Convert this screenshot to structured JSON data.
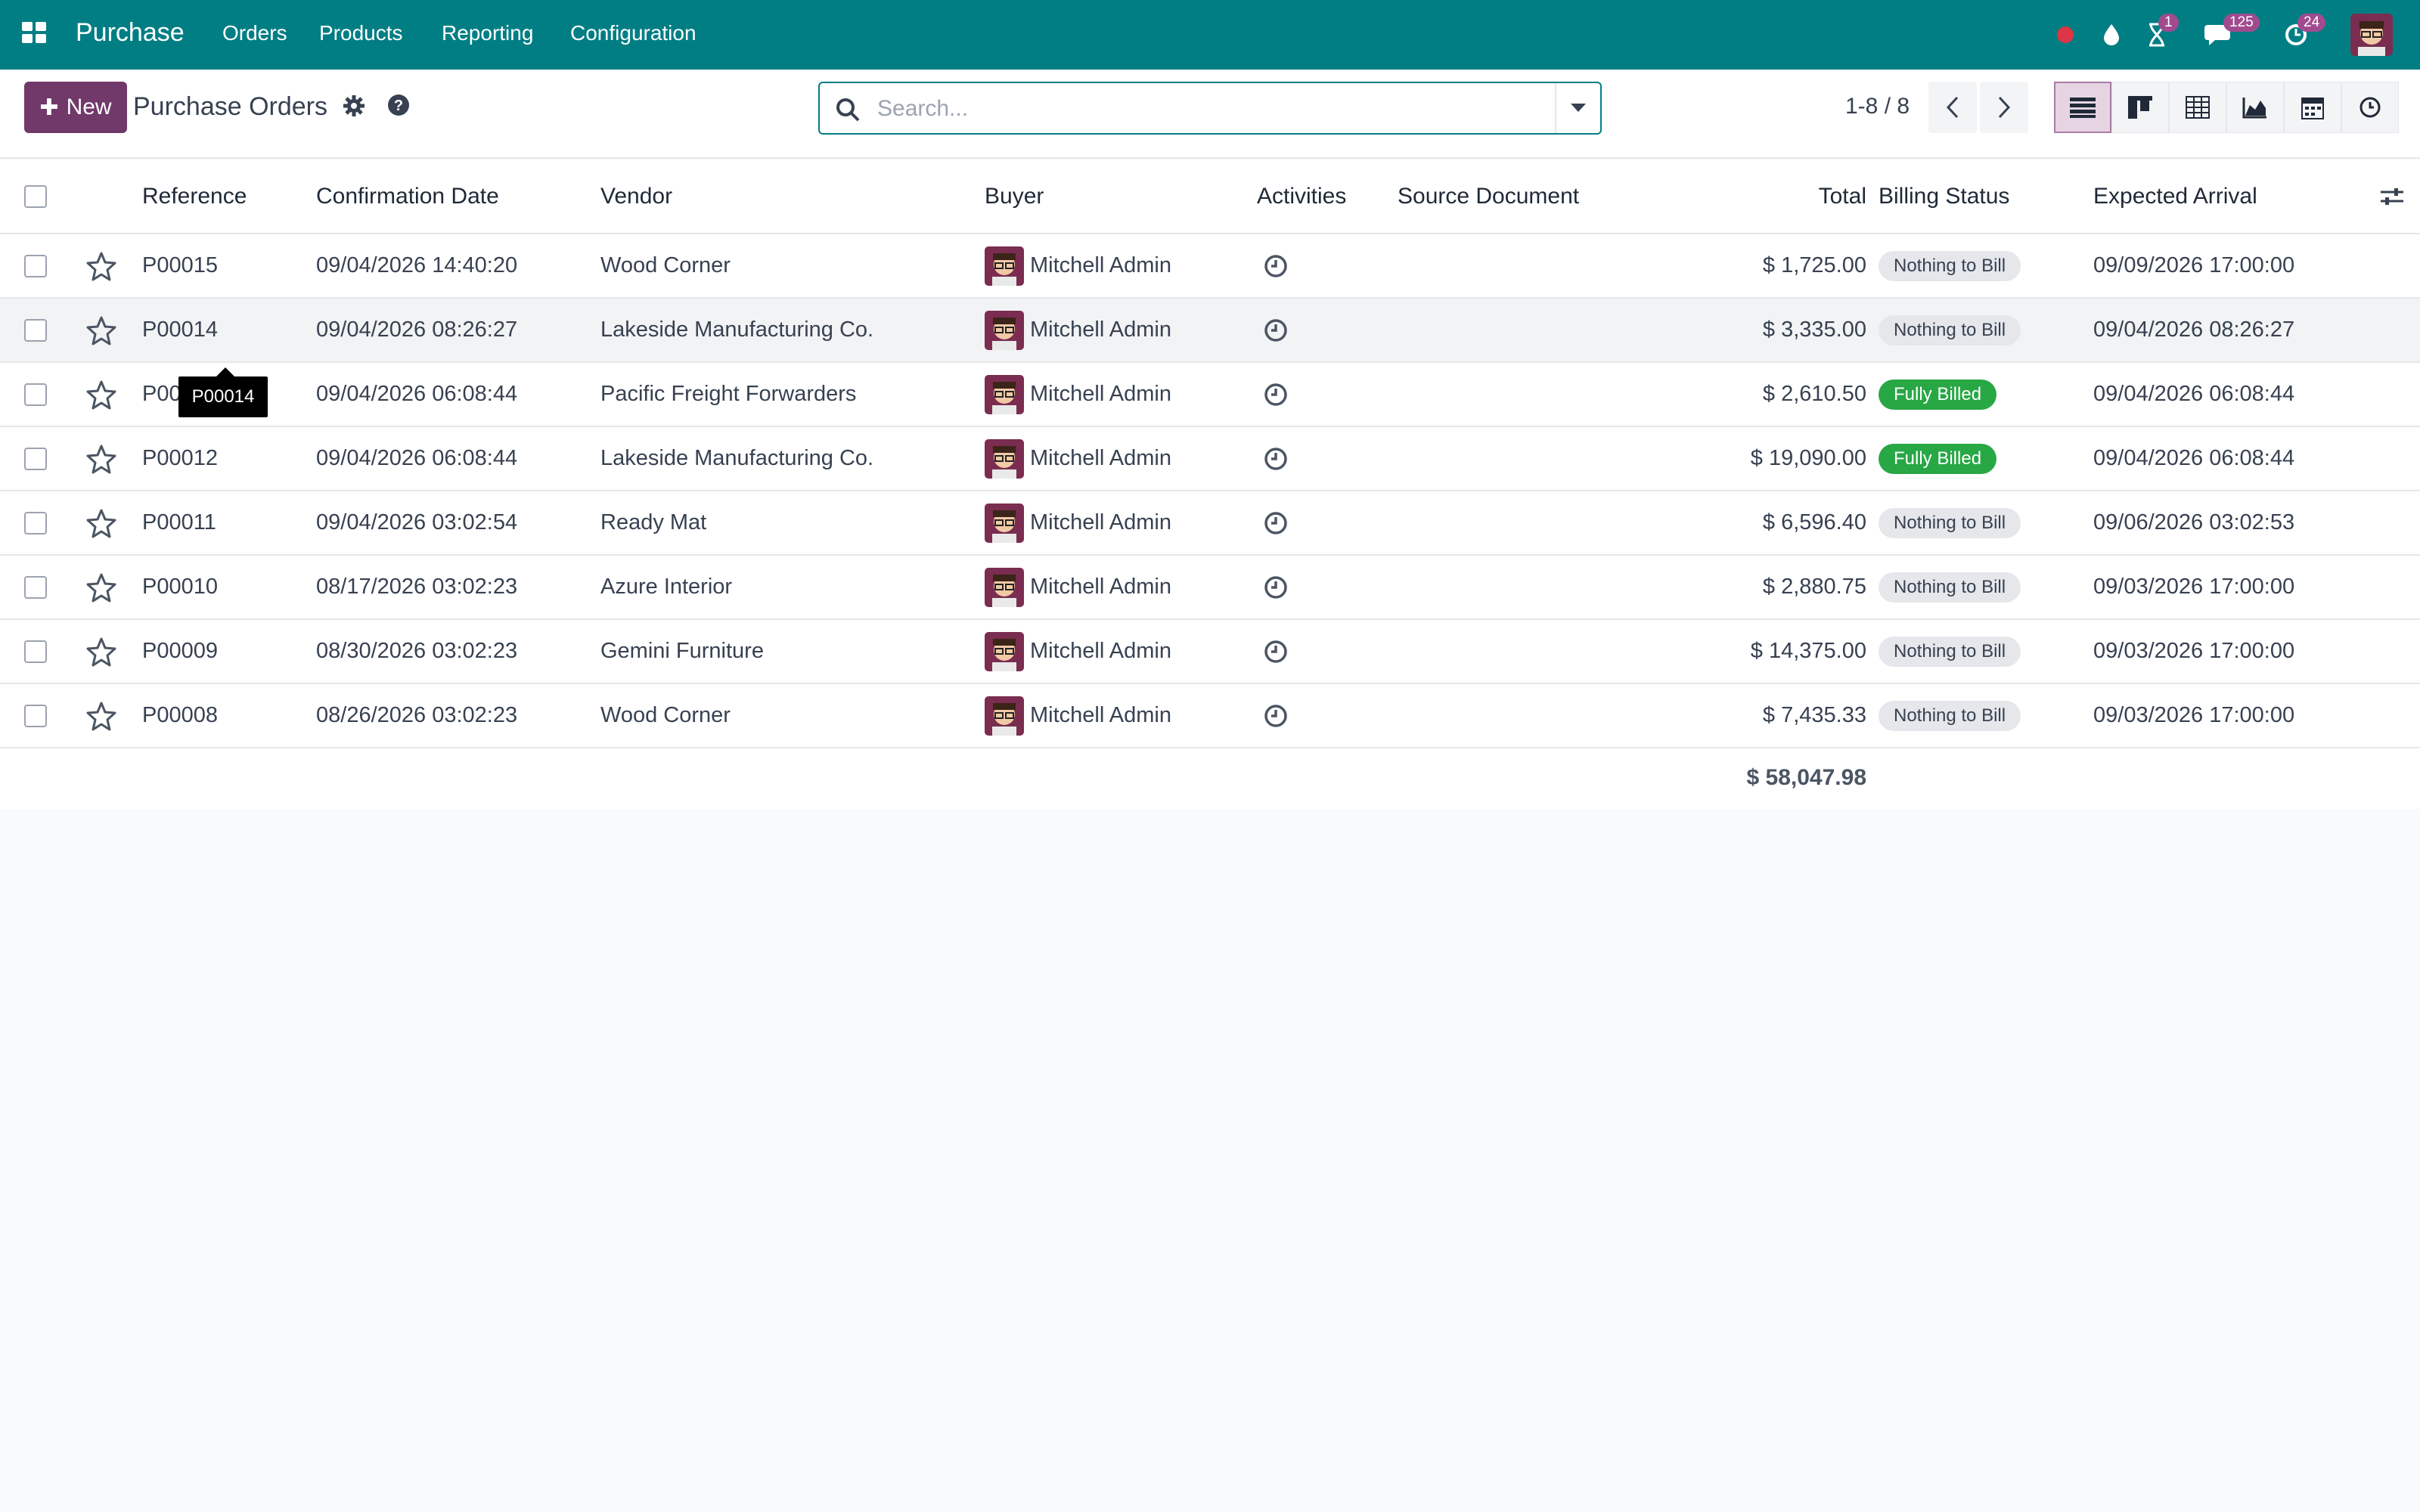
{
  "topbar": {
    "app_name": "Purchase",
    "menu": [
      "Orders",
      "Products",
      "Reporting",
      "Configuration"
    ],
    "badges": {
      "activities": "1",
      "messages": "125",
      "updates": "24"
    },
    "brand_color": "#017e84"
  },
  "control": {
    "new_label": "New",
    "title": "Purchase Orders",
    "search_placeholder": "Search...",
    "pager": "1-8 / 8",
    "views": [
      "list",
      "kanban",
      "pivot",
      "graph",
      "calendar",
      "activity"
    ],
    "active_view": "list"
  },
  "columns": [
    "Reference",
    "Confirmation Date",
    "Vendor",
    "Buyer",
    "Activities",
    "Source Document",
    "Total",
    "Billing Status",
    "Expected Arrival"
  ],
  "orders": [
    {
      "ref": "P00015",
      "date": "09/04/2026 14:40:20",
      "vendor": "Wood Corner",
      "buyer": "Mitchell Admin",
      "source": "",
      "total": "$ 1,725.00",
      "billing": "Nothing to Bill",
      "arrival": "09/09/2026 17:00:00"
    },
    {
      "ref": "P00014",
      "date": "09/04/2026 08:26:27",
      "vendor": "Lakeside Manufacturing Co.",
      "buyer": "Mitchell Admin",
      "source": "",
      "total": "$ 3,335.00",
      "billing": "Nothing to Bill",
      "arrival": "09/04/2026 08:26:27"
    },
    {
      "ref": "P00013",
      "date": "09/04/2026 06:08:44",
      "vendor": "Pacific Freight Forwarders",
      "buyer": "Mitchell Admin",
      "source": "",
      "total": "$ 2,610.50",
      "billing": "Fully Billed",
      "arrival": "09/04/2026 06:08:44"
    },
    {
      "ref": "P00012",
      "date": "09/04/2026 06:08:44",
      "vendor": "Lakeside Manufacturing Co.",
      "buyer": "Mitchell Admin",
      "source": "",
      "total": "$ 19,090.00",
      "billing": "Fully Billed",
      "arrival": "09/04/2026 06:08:44"
    },
    {
      "ref": "P00011",
      "date": "09/04/2026 03:02:54",
      "vendor": "Ready Mat",
      "buyer": "Mitchell Admin",
      "source": "",
      "total": "$ 6,596.40",
      "billing": "Nothing to Bill",
      "arrival": "09/06/2026 03:02:53"
    },
    {
      "ref": "P00010",
      "date": "08/17/2026 03:02:23",
      "vendor": "Azure Interior",
      "buyer": "Mitchell Admin",
      "source": "",
      "total": "$ 2,880.75",
      "billing": "Nothing to Bill",
      "arrival": "09/03/2026 17:00:00"
    },
    {
      "ref": "P00009",
      "date": "08/30/2026 03:02:23",
      "vendor": "Gemini Furniture",
      "buyer": "Mitchell Admin",
      "source": "",
      "total": "$ 14,375.00",
      "billing": "Nothing to Bill",
      "arrival": "09/03/2026 17:00:00"
    },
    {
      "ref": "P00008",
      "date": "08/26/2026 03:02:23",
      "vendor": "Wood Corner",
      "buyer": "Mitchell Admin",
      "source": "",
      "total": "$ 7,435.33",
      "billing": "Nothing to Bill",
      "arrival": "09/03/2026 17:00:00"
    }
  ],
  "grand_total": "$ 58,047.98",
  "tooltip": "P00014",
  "status_colors": {
    "Nothing to Bill": "#e5e7eb",
    "Fully Billed": "#28a745"
  }
}
